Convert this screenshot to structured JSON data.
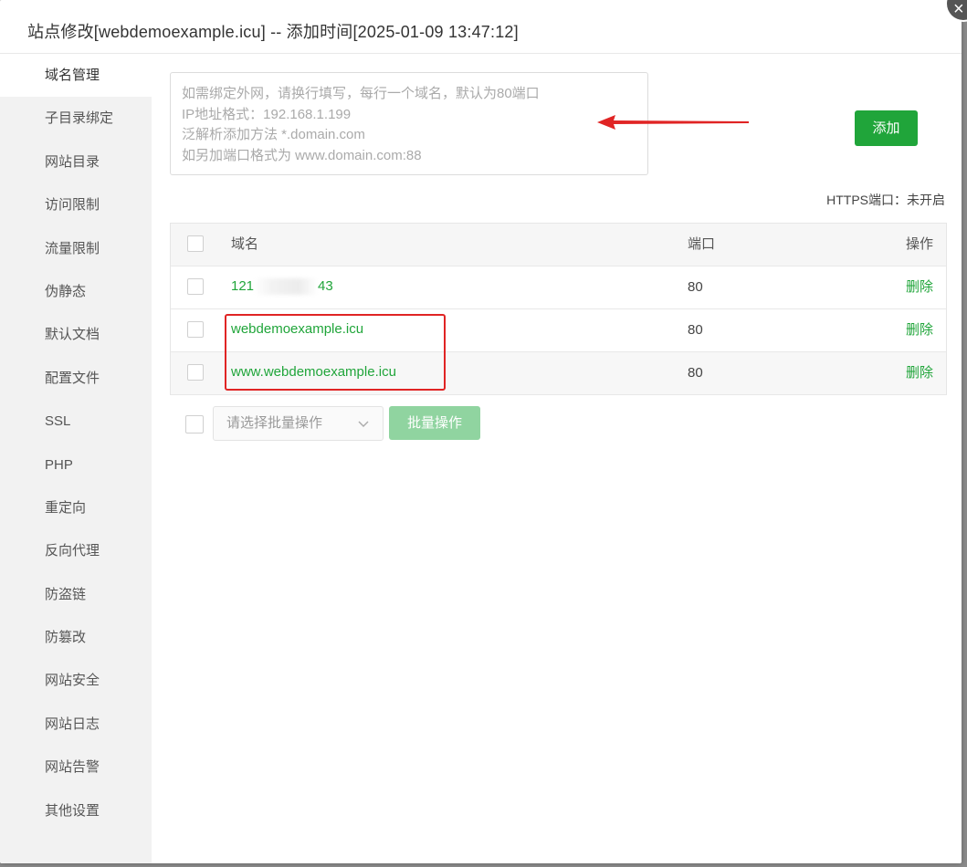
{
  "modal": {
    "title": "站点修改[webdemoexample.icu] -- 添加时间[2025-01-09 13:47:12]",
    "close_glyph": "×"
  },
  "sidebar": {
    "items": [
      {
        "label": "域名管理",
        "active": true
      },
      {
        "label": "子目录绑定"
      },
      {
        "label": "网站目录"
      },
      {
        "label": "访问限制"
      },
      {
        "label": "流量限制"
      },
      {
        "label": "伪静态"
      },
      {
        "label": "默认文档"
      },
      {
        "label": "配置文件"
      },
      {
        "label": "SSL"
      },
      {
        "label": "PHP"
      },
      {
        "label": "重定向"
      },
      {
        "label": "反向代理"
      },
      {
        "label": "防盗链"
      },
      {
        "label": "防篡改"
      },
      {
        "label": "网站安全"
      },
      {
        "label": "网站日志"
      },
      {
        "label": "网站告警"
      },
      {
        "label": "其他设置"
      }
    ]
  },
  "domain_input": {
    "placeholder_lines": [
      "如需绑定外网，请换行填写，每行一个域名，默认为80端口",
      "IP地址格式：192.168.1.199",
      "泛解析添加方法 *.domain.com",
      "如另加端口格式为 www.domain.com:88"
    ]
  },
  "add_button": {
    "label": "添加"
  },
  "https_port": {
    "label": "HTTPS端口：未开启"
  },
  "table": {
    "headers": {
      "domain": "域名",
      "port": "端口",
      "action": "操作"
    },
    "rows": [
      {
        "domain_prefix": "121",
        "domain_suffix": "43",
        "port": "80",
        "action": "删除"
      },
      {
        "domain": "webdemoexample.icu",
        "port": "80",
        "action": "删除"
      },
      {
        "domain": "www.webdemoexample.icu",
        "port": "80",
        "action": "删除"
      }
    ]
  },
  "batch": {
    "select_placeholder": "请选择批量操作",
    "button_label": "批量操作"
  },
  "colors": {
    "accent": "#20a53a",
    "annotation_red": "#e02424"
  }
}
